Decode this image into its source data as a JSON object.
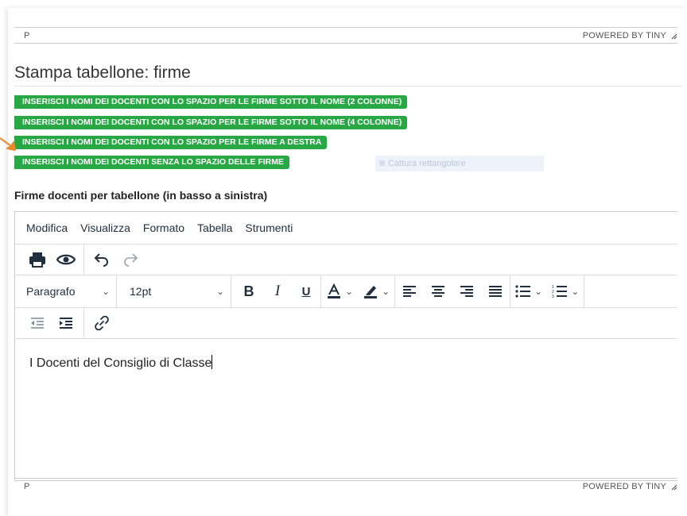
{
  "top_statusbar": {
    "path": "P",
    "branding": "POWERED BY TINY"
  },
  "page_title": "Stampa tabellone: firme",
  "insert_buttons": [
    "INSERISCI I NOMI DEI DOCENTI CON LO SPAZIO PER LE FIRME SOTTO IL NOME (2 COLONNE)",
    "INSERISCI I NOMI DEI DOCENTI CON LO SPAZIO PER LE FIRME SOTTO IL NOME (4 COLONNE)",
    "INSERISCI I NOMI DEI DOCENTI CON LO SPAZIO PER LE FIRME A DESTRA",
    "INSERISCI I NOMI DEI DOCENTI SENZA LO SPAZIO DELLE FIRME"
  ],
  "ghost_tool": "Cattura rettangolare",
  "field_label": "Firme docenti per tabellone (in basso a sinistra)",
  "menubar": [
    "Modifica",
    "Visualizza",
    "Formato",
    "Tabella",
    "Strumenti"
  ],
  "toolbar": {
    "block_format": "Paragrafo",
    "font_size": "12pt"
  },
  "content_text": "I Docenti del Consiglio di Classe",
  "bottom_statusbar": {
    "path": "P",
    "branding": "POWERED BY TINY"
  },
  "colors": {
    "button_green": "#28a745",
    "arrow_orange": "#e8892b"
  }
}
